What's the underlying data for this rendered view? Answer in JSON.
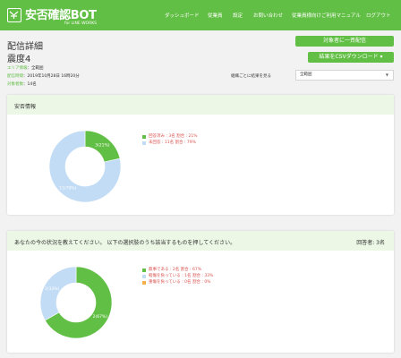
{
  "header": {
    "logo_title": "安否確認BOT",
    "logo_sub": "for LINE WORKS",
    "nav": [
      "ダッシュボード",
      "従業員",
      "設定",
      "お問い合わせ",
      "従業員様向けご利用マニュアル",
      "ログアウト"
    ]
  },
  "page": {
    "title": "配信詳細",
    "subtitle": "震度4",
    "area_label": "エリア情報",
    "area_value": "：全範囲",
    "date_label": "配信時間",
    "date_value": "：2019年10月28日 16時20分",
    "target_label": "対象者数",
    "target_value": "：14名"
  },
  "actions": {
    "resend": "対象者に一斉配信",
    "csv": "結果をCSVダウンロード ▾",
    "sort_label": "組織ごとに結果を見る",
    "select_value": "全範囲"
  },
  "panel1": {
    "title": "安否情報",
    "legend": [
      "回答済み : 3名 割合 : 21%",
      "未回答 : 11名 割合 : 79%"
    ]
  },
  "panel2": {
    "title": "あなたの今の状況を教えてください。 以下の選択肢のうち該当するものを押してください。",
    "count": "回答者: 3名",
    "legend": [
      "無事である : 2名 割合 : 67%",
      "軽傷を負っている : 1名 割合 : 33%",
      "重傷を負っている : 0名 割合 : 0%"
    ]
  },
  "colors": {
    "green": "#62bf45",
    "light_blue": "#c2dcf5",
    "orange": "#f4b04a"
  },
  "chart_data": [
    {
      "type": "pie",
      "categories": [
        "回答済み",
        "未回答"
      ],
      "values": [
        3,
        11
      ],
      "labels": [
        "3(21%)",
        "11(79%)"
      ],
      "colors": [
        "#62bf45",
        "#c2dcf5"
      ],
      "donut": true
    },
    {
      "type": "pie",
      "categories": [
        "無事である",
        "軽傷を負っている",
        "重傷を負っている"
      ],
      "values": [
        2,
        1,
        0
      ],
      "labels": [
        "2(67%)",
        "1(33%)",
        ""
      ],
      "colors": [
        "#62bf45",
        "#c2dcf5",
        "#f4b04a"
      ],
      "donut": true
    }
  ]
}
